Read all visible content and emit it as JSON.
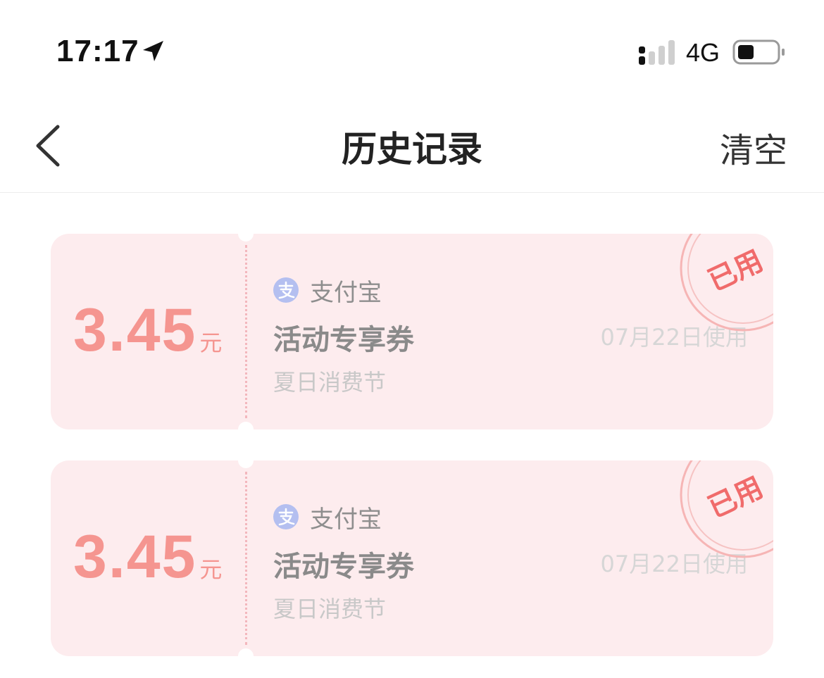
{
  "status_bar": {
    "time": "17:17",
    "network": "4G",
    "icons": [
      "location-arrow-icon",
      "signal-icon",
      "battery-icon"
    ]
  },
  "nav": {
    "title": "历史记录",
    "clear_label": "清空",
    "back_icon": "chevron-left-icon"
  },
  "colors": {
    "card_bg": "#fdecee",
    "amount": "#f59590",
    "stamp": "#f06b6b",
    "alipay_blue": "#b4bff0"
  },
  "coupons": [
    {
      "amount": "3.45",
      "unit": "元",
      "brand": "支付宝",
      "title": "活动专享券",
      "subtitle": "夏日消费节",
      "used_date": "07月22日使用",
      "stamp": "已用"
    },
    {
      "amount": "3.45",
      "unit": "元",
      "brand": "支付宝",
      "title": "活动专享券",
      "subtitle": "夏日消费节",
      "used_date": "07月22日使用",
      "stamp": "已用"
    }
  ]
}
